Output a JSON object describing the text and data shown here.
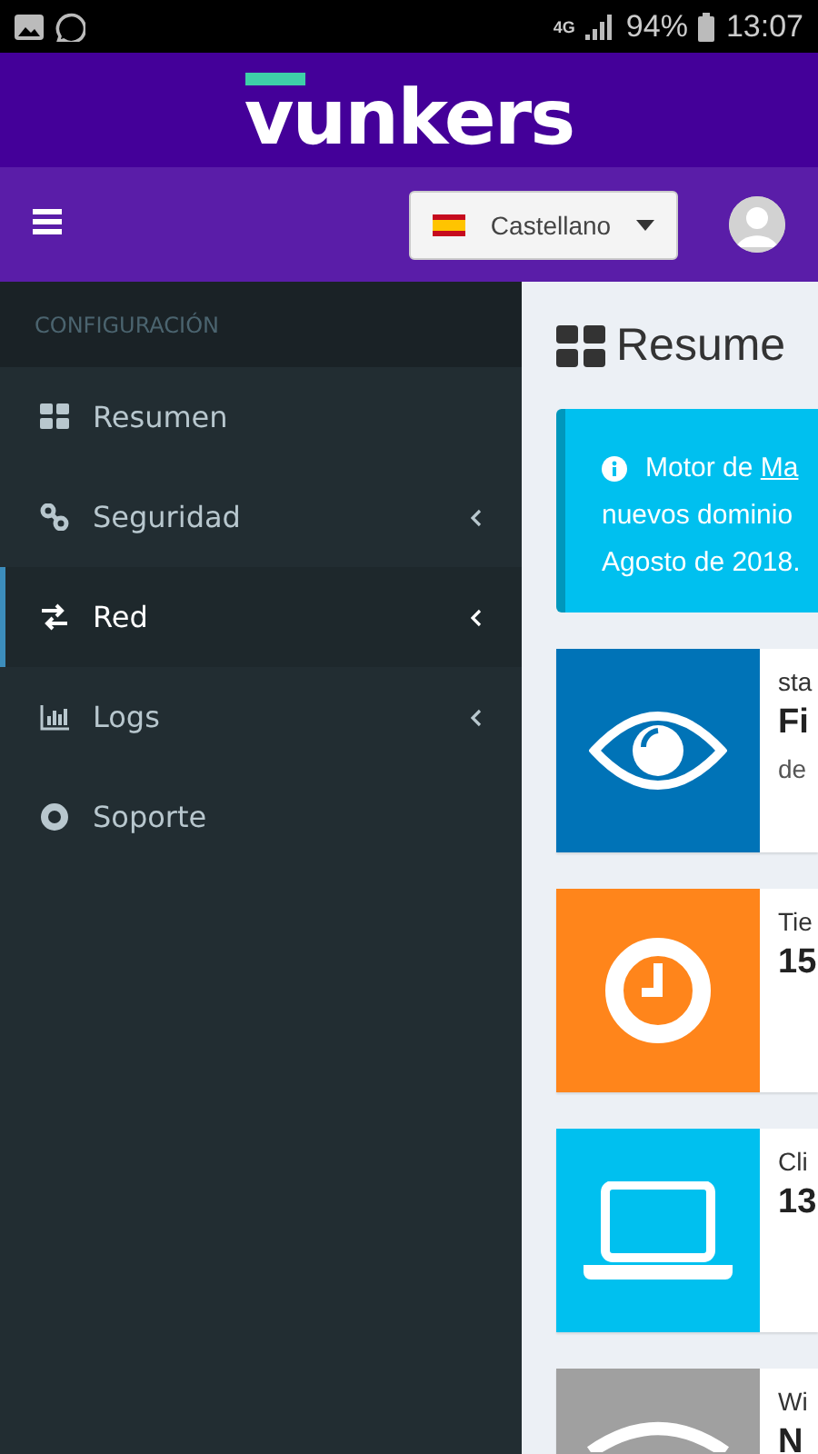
{
  "status_bar": {
    "network": "4G",
    "battery": "94%",
    "time": "13:07"
  },
  "brand": {
    "logo": "vunkers"
  },
  "navbar": {
    "language": "Castellano"
  },
  "sidebar": {
    "header": "CONFIGURACIÓN",
    "items": [
      {
        "kind": "dashboard",
        "label": "Resumen",
        "expandable": false,
        "selected": false
      },
      {
        "kind": "link",
        "label": "Seguridad",
        "expandable": true,
        "selected": false
      },
      {
        "kind": "exchange",
        "label": "Red",
        "expandable": true,
        "selected": true
      },
      {
        "kind": "chart",
        "label": "Logs",
        "expandable": true,
        "selected": false
      },
      {
        "kind": "lifebuoy",
        "label": "Soporte",
        "expandable": false,
        "selected": false
      }
    ]
  },
  "content": {
    "title": "Resume",
    "alert": {
      "lines": [
        "Motor de",
        "nuevos dominio",
        "Agosto de 2018."
      ],
      "link": "Ma"
    },
    "cards": [
      {
        "kind": "eye",
        "color": "#0073b7",
        "label": "sta",
        "value": "Fi",
        "note": "de"
      },
      {
        "kind": "clock",
        "color": "#ff851b",
        "label": "Tie",
        "value": "15"
      },
      {
        "kind": "laptop",
        "color": "#00c0ef",
        "label": "Cli",
        "value": "13"
      },
      {
        "kind": "wifi",
        "color": "#a0a0a0",
        "label": "Wi",
        "value": "N"
      }
    ]
  }
}
